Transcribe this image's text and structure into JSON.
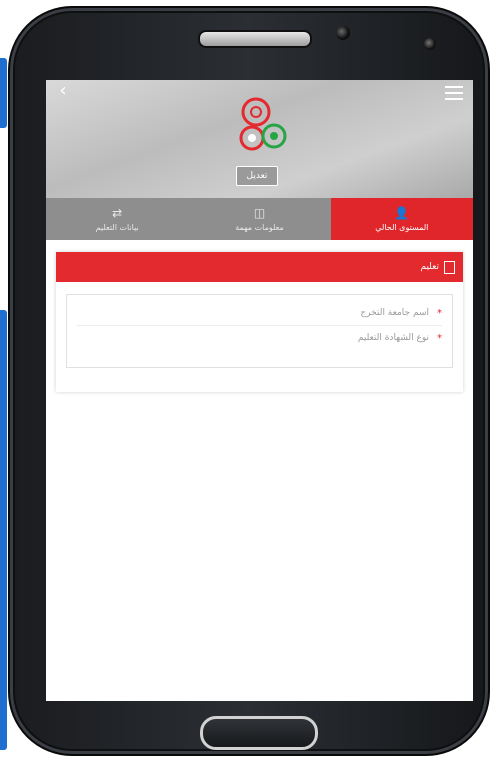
{
  "header": {
    "back_glyph": "‹",
    "profile_button": "تعديل"
  },
  "tabs": [
    {
      "label": "المستوى الحالي",
      "icon": "user-icon",
      "glyph": "👤",
      "active": true
    },
    {
      "label": "معلومات مهمة",
      "icon": "info-icon",
      "glyph": "◫",
      "active": false
    },
    {
      "label": "بيانات التعليم",
      "icon": "shuffle-icon",
      "glyph": "⇄",
      "active": false
    }
  ],
  "panel": {
    "title": "تعليم",
    "fields": [
      {
        "label": "اسم جامعة التخرج",
        "required_mark": "*"
      },
      {
        "label": "نوع الشهادة التعليم",
        "required_mark": "*"
      }
    ]
  },
  "colors": {
    "accent": "#e22a2f",
    "tab_bar": "#8e8e8e"
  }
}
